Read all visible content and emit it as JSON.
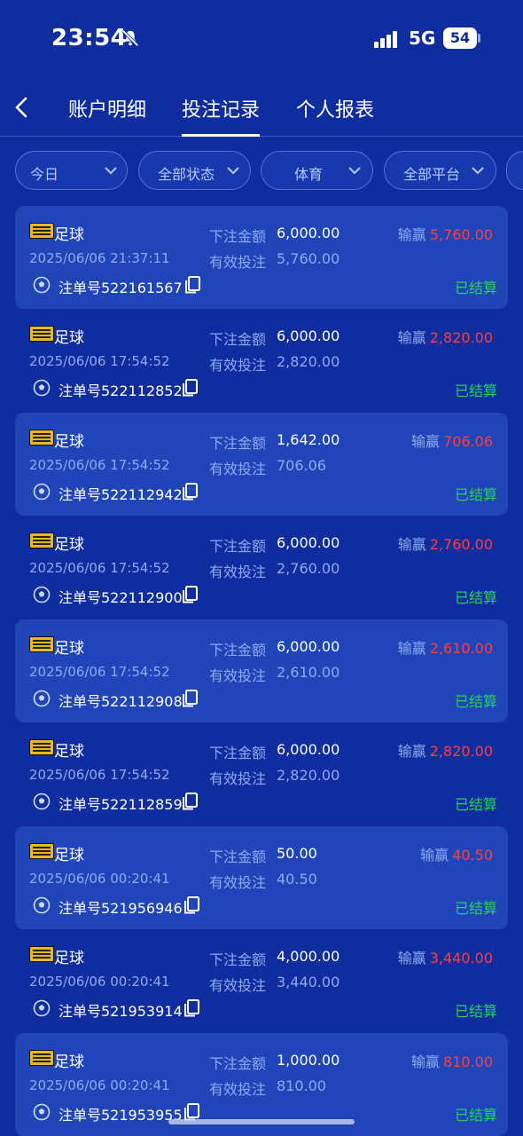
{
  "status_bar": {
    "time": "23:54",
    "network": "5G",
    "battery": "54"
  },
  "nav": {
    "tabs": [
      {
        "label": "账户明细"
      },
      {
        "label": "投注记录"
      },
      {
        "label": "个人报表"
      }
    ]
  },
  "filters": [
    {
      "label": "今日"
    },
    {
      "label": "全部状态"
    },
    {
      "label": "体育"
    },
    {
      "label": "全部平台"
    }
  ],
  "labels": {
    "bet_amount": "下注金额",
    "valid_bet": "有效投注",
    "win_loss": "输赢",
    "order_prefix": "注单号"
  },
  "records": [
    {
      "sport": "足球",
      "datetime": "2025/06/06 21:37:11",
      "order_no": "注单号522161567",
      "bet_amount": "6,000.00",
      "valid_bet": "5,760.00",
      "win_loss": "5,760.00",
      "status": "已结算"
    },
    {
      "sport": "足球",
      "datetime": "2025/06/06 17:54:52",
      "order_no": "注单号522112852",
      "bet_amount": "6,000.00",
      "valid_bet": "2,820.00",
      "win_loss": "2,820.00",
      "status": "已结算"
    },
    {
      "sport": "足球",
      "datetime": "2025/06/06 17:54:52",
      "order_no": "注单号522112942",
      "bet_amount": "1,642.00",
      "valid_bet": "706.06",
      "win_loss": "706.06",
      "status": "已结算"
    },
    {
      "sport": "足球",
      "datetime": "2025/06/06 17:54:52",
      "order_no": "注单号522112900",
      "bet_amount": "6,000.00",
      "valid_bet": "2,760.00",
      "win_loss": "2,760.00",
      "status": "已结算"
    },
    {
      "sport": "足球",
      "datetime": "2025/06/06 17:54:52",
      "order_no": "注单号522112908",
      "bet_amount": "6,000.00",
      "valid_bet": "2,610.00",
      "win_loss": "2,610.00",
      "status": "已结算"
    },
    {
      "sport": "足球",
      "datetime": "2025/06/06 17:54:52",
      "order_no": "注单号522112859",
      "bet_amount": "6,000.00",
      "valid_bet": "2,820.00",
      "win_loss": "2,820.00",
      "status": "已结算"
    },
    {
      "sport": "足球",
      "datetime": "2025/06/06 00:20:41",
      "order_no": "注单号521956946",
      "bet_amount": "50.00",
      "valid_bet": "40.50",
      "win_loss": "40.50",
      "status": "已结算"
    },
    {
      "sport": "足球",
      "datetime": "2025/06/06 00:20:41",
      "order_no": "注单号521953914",
      "bet_amount": "4,000.00",
      "valid_bet": "3,440.00",
      "win_loss": "3,440.00",
      "status": "已结算"
    },
    {
      "sport": "足球",
      "datetime": "2025/06/06 00:20:41",
      "order_no": "注单号521953955",
      "bet_amount": "1,000.00",
      "valid_bet": "810.00",
      "win_loss": "810.00",
      "status": "已结算"
    }
  ],
  "colors": {
    "background": "#0f2d9e",
    "card": "#1f45b8",
    "loss_value": "#ff3d3d",
    "settled": "#22d35a",
    "muted_text": "#8faaf2"
  }
}
